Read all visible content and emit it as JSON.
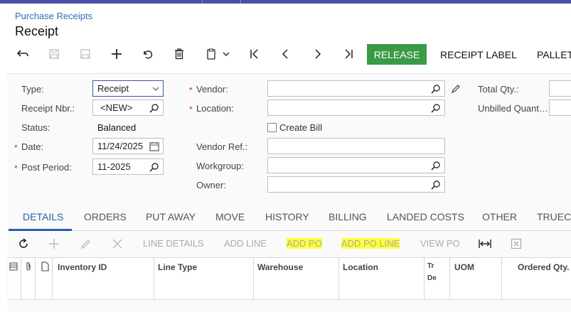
{
  "breadcrumb": "Purchase Receipts",
  "title": "Receipt",
  "toolbar": {
    "release_label": "RELEASE",
    "receipt_label": "RECEIPT LABEL",
    "pallet_label": "PALLET"
  },
  "form": {
    "type_label": "Type:",
    "type_value": "Receipt",
    "receipt_nbr_label": "Receipt Nbr.:",
    "receipt_nbr_value": "<NEW>",
    "status_label": "Status:",
    "status_value": "Balanced",
    "date_label": "Date:",
    "date_value": "11/24/2025",
    "post_period_label": "Post Period:",
    "post_period_value": "11-2025",
    "vendor_label": "Vendor:",
    "location_label": "Location:",
    "create_bill_label": "Create Bill",
    "vendor_ref_label": "Vendor Ref.:",
    "workgroup_label": "Workgroup:",
    "owner_label": "Owner:",
    "total_qty_label": "Total Qty.:",
    "unbilled_qty_label": "Unbilled Quant…"
  },
  "tabs": [
    "DETAILS",
    "ORDERS",
    "PUT AWAY",
    "MOVE",
    "HISTORY",
    "BILLING",
    "LANDED COSTS",
    "OTHER",
    "TRUECO"
  ],
  "grid_toolbar": {
    "line_details": "LINE DETAILS",
    "add_line": "ADD LINE",
    "add_po": "ADD PO",
    "add_po_line": "ADD PO LINE",
    "view_po": "VIEW PO"
  },
  "grid_columns": [
    "Inventory ID",
    "Line Type",
    "Warehouse",
    "Location",
    "Tr",
    "De",
    "UOM",
    "Ordered Qty."
  ],
  "colors": {
    "accent": "#2a5ea8",
    "release": "#3a9b46",
    "highlight": "#ffff3c",
    "topbar": "#4b4fa8"
  }
}
